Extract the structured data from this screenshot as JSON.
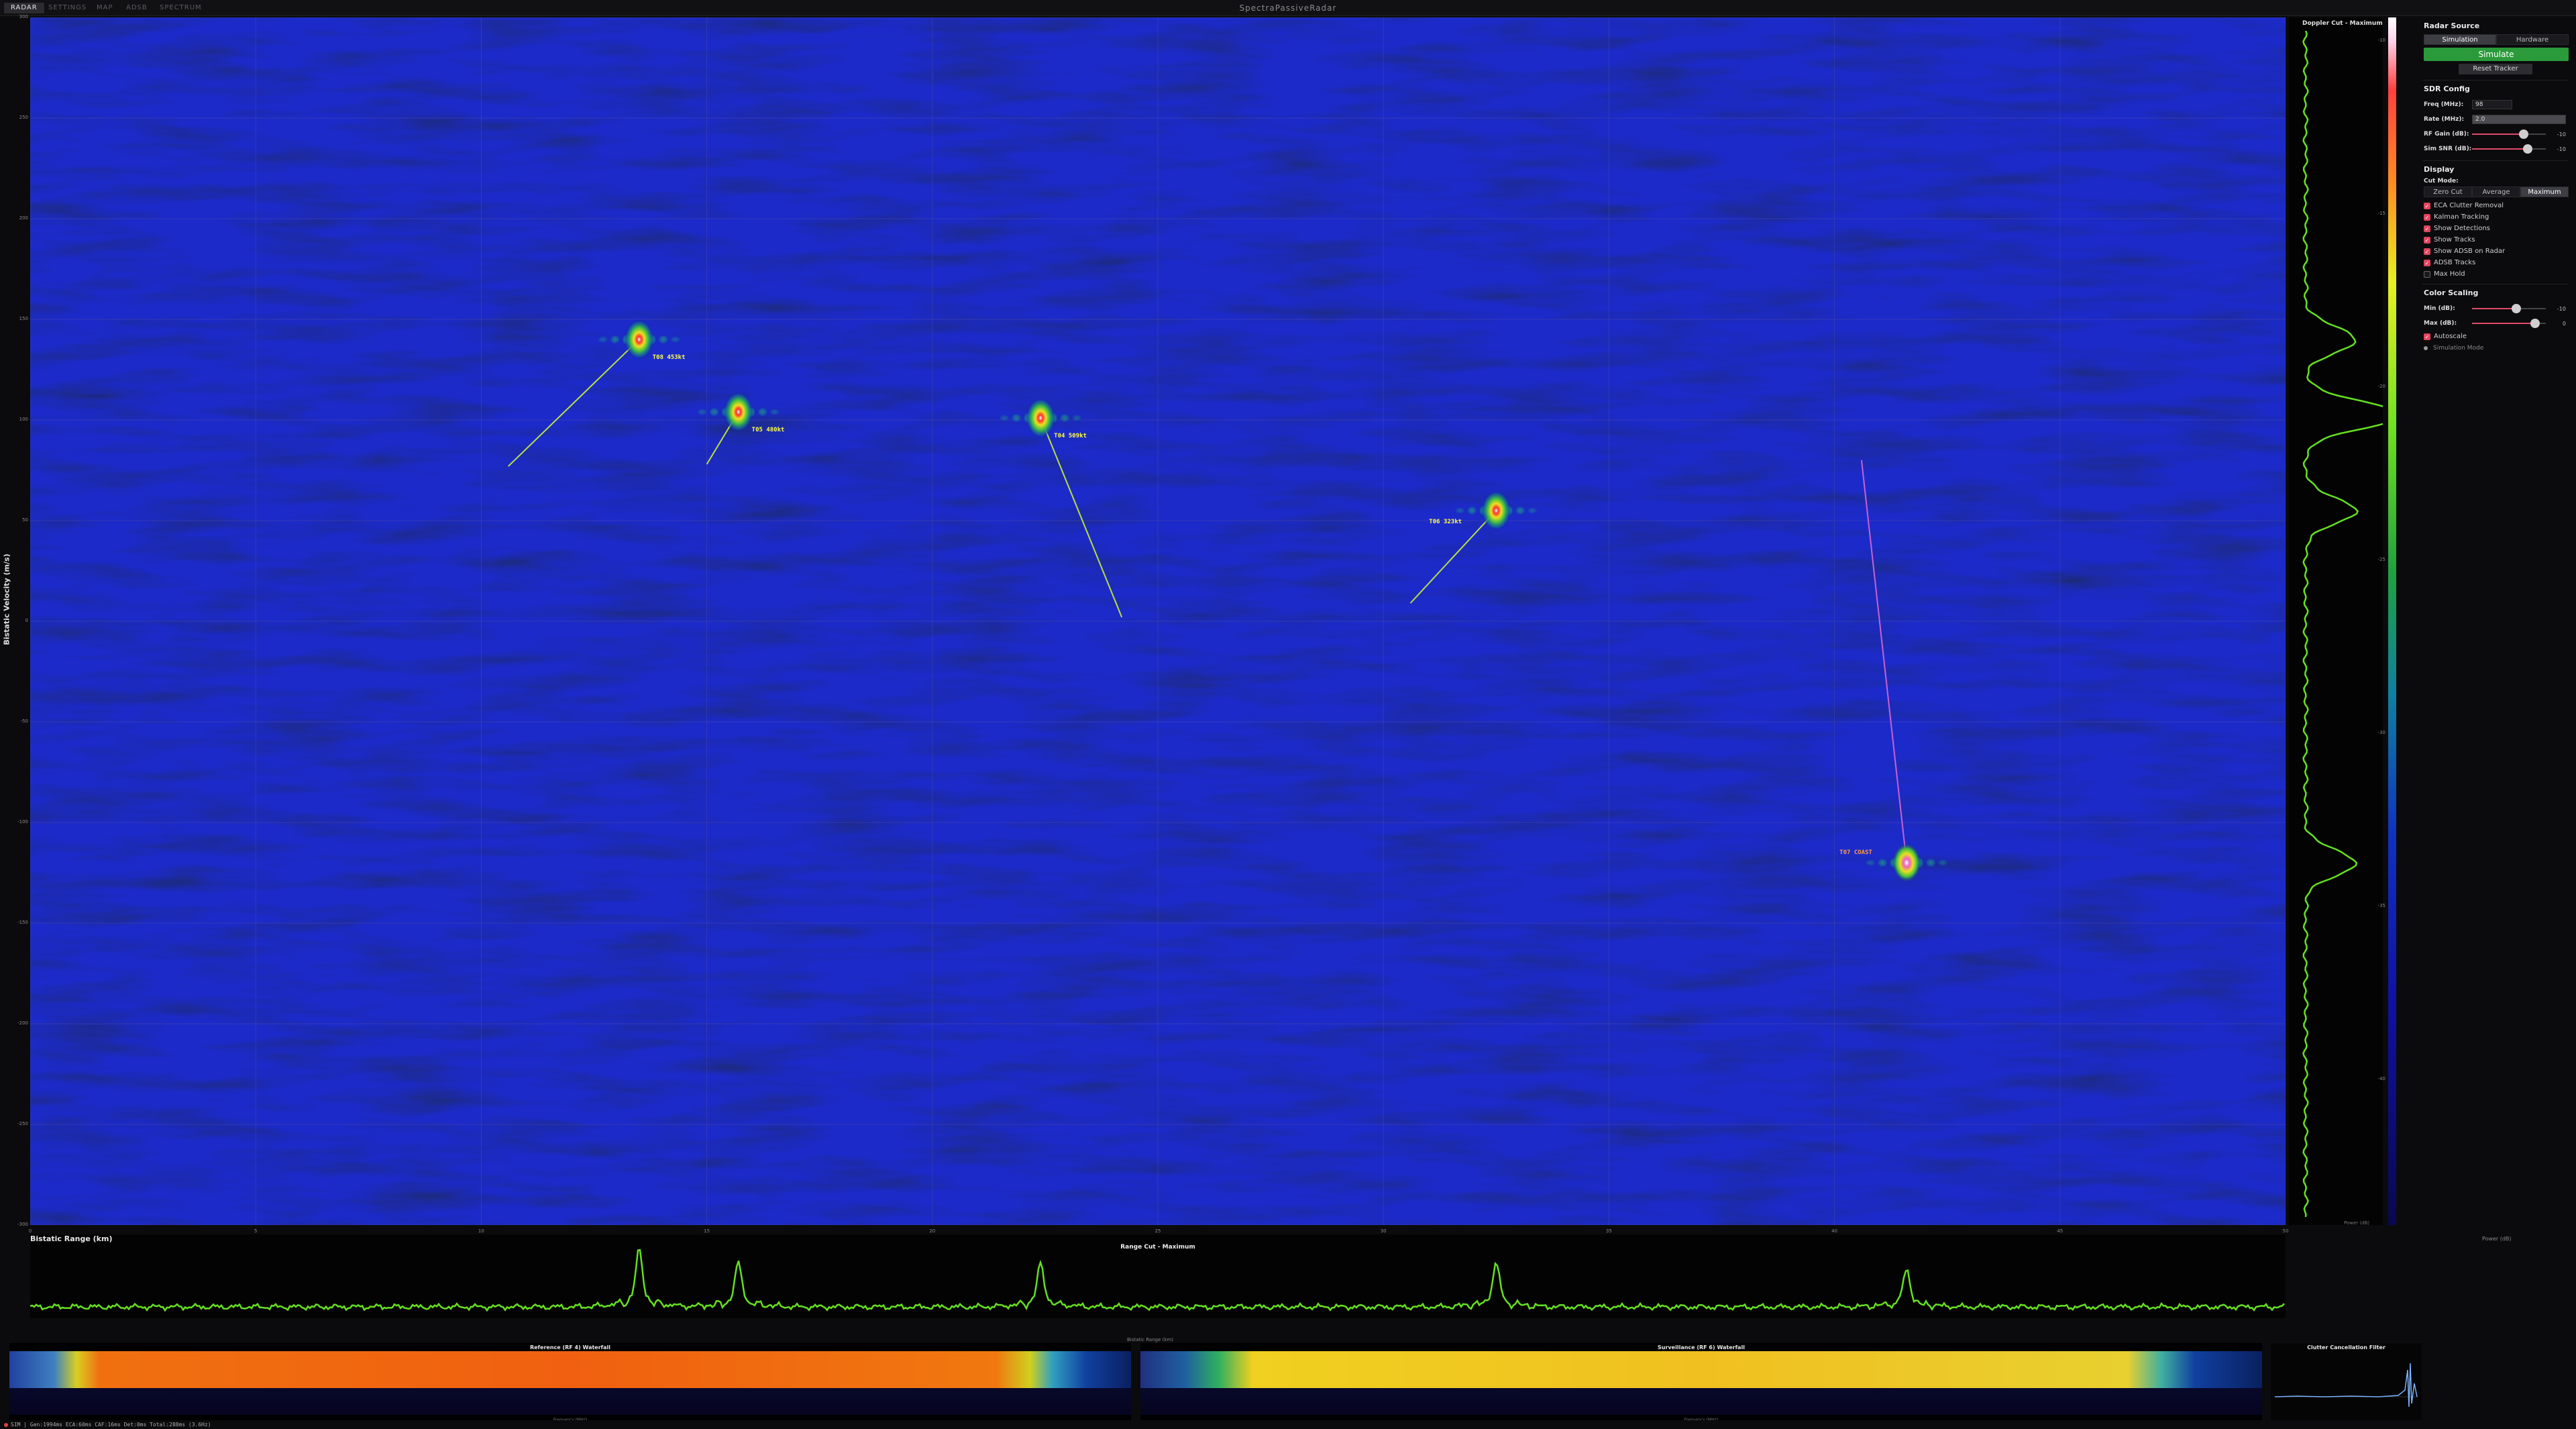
{
  "app": {
    "title": "SpectraPassiveRadar",
    "tabs": [
      {
        "label": "RADAR",
        "active": true
      },
      {
        "label": "SETTINGS",
        "active": false
      },
      {
        "label": "MAP",
        "active": false
      },
      {
        "label": "ADSB",
        "active": false
      },
      {
        "label": "SPECTRUM",
        "active": false
      }
    ]
  },
  "radar": {
    "ylabel": "Bistatic Velocity (m/s)",
    "y_ticks": [
      "300",
      "250",
      "200",
      "150",
      "100",
      "50",
      "0",
      "-50",
      "-100",
      "-150",
      "-200",
      "-250",
      "-300"
    ],
    "x_ticks": [
      "0",
      "5",
      "10",
      "15",
      "20",
      "25",
      "30",
      "35",
      "40",
      "45",
      "50"
    ],
    "tracks": [
      {
        "label": "T08 453kt",
        "color": "#ffff44",
        "range_km": 13.5,
        "vel": 140,
        "trail": [
          [
            10.6,
            77
          ],
          [
            13.5,
            140
          ]
        ]
      },
      {
        "label": "T05 480kt",
        "color": "#ffff44",
        "range_km": 15.7,
        "vel": 104,
        "trail": [
          [
            15.0,
            78
          ],
          [
            15.7,
            104
          ]
        ]
      },
      {
        "label": "T04 509kt",
        "color": "#ffff44",
        "range_km": 22.4,
        "vel": 101,
        "trail": [
          [
            24.2,
            2
          ],
          [
            22.4,
            101
          ]
        ]
      },
      {
        "label": "T06 323kt",
        "color": "#ffff44",
        "range_km": 32.5,
        "vel": 55,
        "trail": [
          [
            30.6,
            9
          ],
          [
            32.5,
            55
          ]
        ]
      },
      {
        "label": "T07 COAST",
        "color": "#e060c0",
        "range_km": 41.6,
        "vel": -120,
        "trail": [
          [
            40.6,
            80
          ],
          [
            41.6,
            -120
          ]
        ]
      }
    ]
  },
  "doppler_cut": {
    "title": "Doppler Cut - Maximum",
    "xlabel": "Power (dB)"
  },
  "colorbar": {
    "ticks": [
      "-10",
      "-15",
      "-20",
      "-25",
      "-30",
      "-35",
      "-40"
    ]
  },
  "panel": {
    "radar_source": {
      "title": "Radar Source",
      "options": [
        "Simulation",
        "Hardware"
      ],
      "selected": "Simulation",
      "simulate_label": "Simulate",
      "reset_label": "Reset Tracker"
    },
    "sdr_config": {
      "title": "SDR Config",
      "freq_label": "Freq (MHz):",
      "freq_value": "98",
      "rate_label": "Rate (MHz):",
      "rate_value": "2.0",
      "rf_gain_label": "RF Gain (dB):",
      "rf_gain_value": "-10",
      "rf_gain_level": 0.7,
      "sim_snr_label": "Sim SNR (dB):",
      "sim_snr_value": "-10",
      "sim_snr_level": 0.75
    },
    "display": {
      "title": "Display",
      "cut_mode_label": "Cut Mode:",
      "cut_modes": [
        "Zero Cut",
        "Average",
        "Maximum"
      ],
      "cut_mode_selected": "Maximum",
      "checks": [
        {
          "label": "ECA Clutter Removal",
          "checked": true
        },
        {
          "label": "Kalman Tracking",
          "checked": true
        },
        {
          "label": "Show Detections",
          "checked": true
        },
        {
          "label": "Show Tracks",
          "checked": true
        },
        {
          "label": "Show ADSB on Radar",
          "checked": true
        },
        {
          "label": "ADSB Tracks",
          "checked": true
        },
        {
          "label": "Max Hold",
          "checked": false
        }
      ]
    },
    "color_scaling": {
      "title": "Color Scaling",
      "min_label": "Min (dB):",
      "min_value": "-10",
      "min_level": 0.6,
      "max_label": "Max (dB):",
      "max_value": "0",
      "max_level": 0.85,
      "autoscale_label": "Autoscale",
      "autoscale": true
    },
    "sim_mode_label": "Simulation Mode"
  },
  "range_cut": {
    "section_title": "Bistatic Range (km)",
    "title": "Range Cut - Maximum",
    "power_label": "Power (dB)",
    "x_label": "Bistatic Range (km)",
    "peaks": [
      {
        "range_km": 13.5,
        "height": 0.9
      },
      {
        "range_km": 15.7,
        "height": 0.7
      },
      {
        "range_km": 22.4,
        "height": 0.68
      },
      {
        "range_km": 32.5,
        "height": 0.7
      },
      {
        "range_km": 41.6,
        "height": 0.6
      }
    ]
  },
  "waterfalls": {
    "reference": {
      "title": "Reference (RF 4) Waterfall",
      "x_label": "Frequency (MHz)"
    },
    "surveillance": {
      "title": "Surveillance (RF 6) Waterfall",
      "x_label": "Frequency (MHz)"
    },
    "ccf_title": "Clutter Cancellation Filter"
  },
  "status": {
    "text": "SIM | Gen:1994ms ECA:60ms CAF:16ms Det:0ms Total:288ms (3.6Hz)"
  },
  "colors": {
    "background": "#0b0b0d",
    "radar_noise": "#10118a",
    "trace": "#66e020",
    "accent_green": "#2a9a3a",
    "accent_pink": "#e2445e"
  }
}
